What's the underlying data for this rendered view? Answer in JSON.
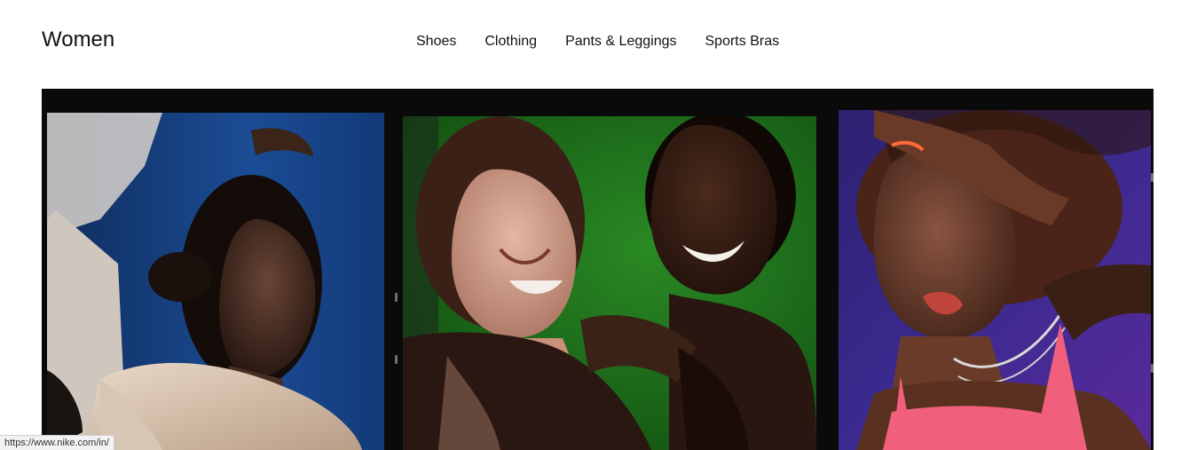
{
  "header": {
    "title": "Women",
    "nav": [
      {
        "label": "Shoes"
      },
      {
        "label": "Clothing"
      },
      {
        "label": "Pants & Leggings"
      },
      {
        "label": "Sports Bras"
      }
    ]
  },
  "hero": {
    "panels": [
      {
        "icon": "portrait-blue-backdrop"
      },
      {
        "icon": "two-women-green-backdrop"
      },
      {
        "icon": "portrait-purple-backdrop"
      }
    ]
  },
  "status_bar": {
    "url": "https://www.nike.com/in/"
  },
  "colors": {
    "text": "#111111",
    "background": "#ffffff",
    "film_frame": "#0a0a0b",
    "blue_backdrop": "#1b4c95",
    "green_backdrop": "#1d6a1a",
    "purple_backdrop": "#3b2a8f",
    "pink_top": "#f0607c"
  }
}
